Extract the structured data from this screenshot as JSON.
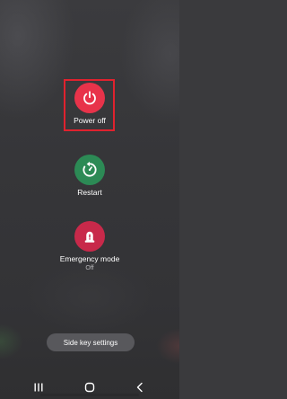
{
  "power_menu": {
    "power_off": {
      "label": "Power off",
      "icon": "power-icon",
      "color": "#e8334a"
    },
    "restart": {
      "label": "Restart",
      "icon": "restart-icon",
      "color": "#2c8a55"
    },
    "emergency": {
      "label": "Emergency mode",
      "status": "Off",
      "icon": "emergency-beacon-icon",
      "color": "#c8294a"
    },
    "highlight_color": "#e0222e"
  },
  "side_key_settings": {
    "label": "Side key settings"
  },
  "nav_bar": {
    "recents_icon": "recents-icon",
    "home_icon": "home-icon",
    "back_icon": "back-icon"
  }
}
